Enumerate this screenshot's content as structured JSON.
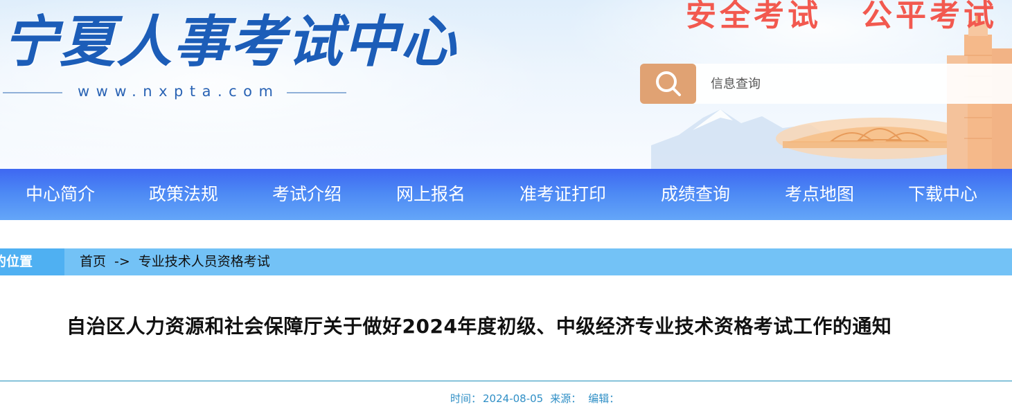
{
  "header": {
    "logo_title": "宁夏人事考试中心",
    "logo_url": "www.nxpta.com",
    "slogans": [
      "安全考试",
      "公平考试"
    ],
    "search": {
      "placeholder": "信息查询",
      "icon": "search-icon"
    }
  },
  "nav": {
    "items": [
      {
        "label": "中心简介"
      },
      {
        "label": "政策法规"
      },
      {
        "label": "考试介绍"
      },
      {
        "label": "网上报名"
      },
      {
        "label": "准考证打印"
      },
      {
        "label": "成绩查询"
      },
      {
        "label": "考点地图"
      },
      {
        "label": "下载中心"
      }
    ]
  },
  "breadcrumb": {
    "tag": "的位置",
    "items": [
      "首页",
      "专业技术人员资格考试"
    ],
    "separator": "->"
  },
  "article": {
    "title": "自治区人力资源和社会保障厅关于做好2024年度初级、中级经济专业技术资格考试工作的通知",
    "time_label": "时间：",
    "time_value": "2024-08-05",
    "source_label": "来源：",
    "editor_label": "编辑："
  },
  "colors": {
    "nav_top": "#3e67f2",
    "nav_bottom": "#64a6f8",
    "breadcrumb_bg": "#73c2f6",
    "search_button": "#e0a273",
    "slogan": "#f2594f",
    "logo": "#1c5db8",
    "meta_text": "#2f8fc6"
  }
}
